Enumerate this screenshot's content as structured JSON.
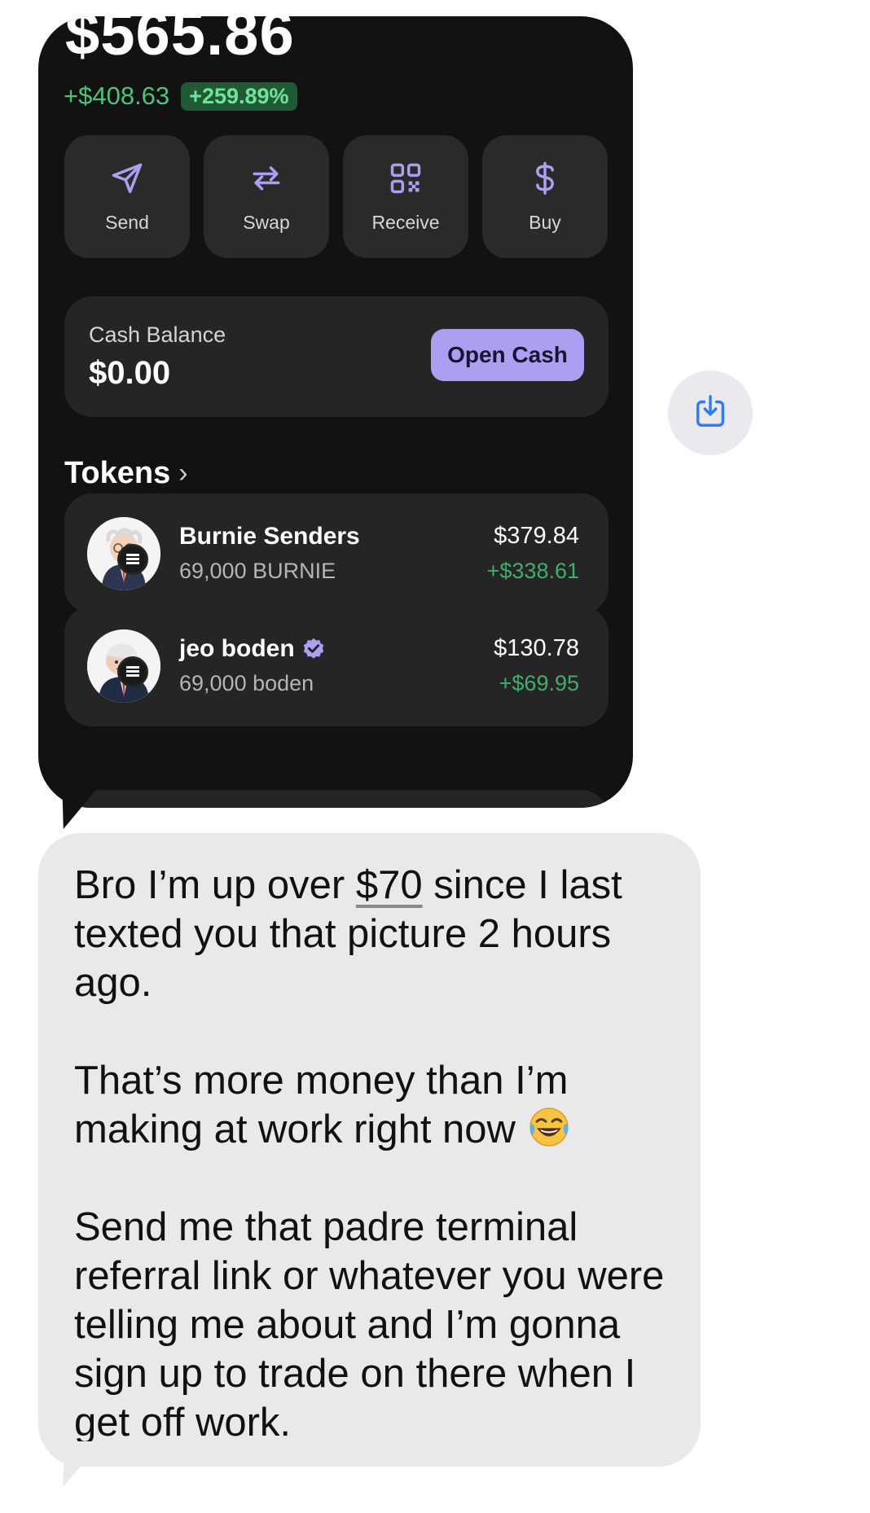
{
  "wallet": {
    "total_value": "$565.86",
    "change_amount": "+$408.63",
    "change_percent": "+259.89%",
    "actions": [
      {
        "label": "Send",
        "icon": "send-icon"
      },
      {
        "label": "Swap",
        "icon": "swap-icon"
      },
      {
        "label": "Receive",
        "icon": "qr-code-icon"
      },
      {
        "label": "Buy",
        "icon": "dollar-icon"
      }
    ],
    "cash": {
      "title": "Cash Balance",
      "value": "$0.00",
      "button_label": "Open Cash"
    },
    "tokens_header": "Tokens",
    "tokens": [
      {
        "name": "Burnie Senders",
        "amount": "69,000 BURNIE",
        "value": "$379.84",
        "change": "+$338.61",
        "verified": false
      },
      {
        "name": "jeo boden",
        "amount": "69,000 boden",
        "value": "$130.78",
        "change": "+$69.95",
        "verified": true
      }
    ]
  },
  "save_button": {
    "icon": "save-to-photos-icon"
  },
  "message": {
    "line1_prefix": "Bro I’m up over ",
    "line1_link": "$70",
    "line1_suffix": " since I last texted you that picture 2 hours ago.",
    "paragraph2": "That’s more money than I’m making at work right now",
    "paragraph2_emoji": "face-with-tears-of-joy",
    "paragraph3": "Send me that padre terminal referral link or whatever you were telling me about and I’m gonna sign up to trade on there when I get off work."
  },
  "colors": {
    "bubble_dark": "#121212",
    "card": "#252525",
    "accent_purple": "#ab9ff2",
    "gain_green": "#3fae6c",
    "incoming_bubble": "#e9e9eb",
    "save_icon_blue": "#2f7cf6"
  }
}
